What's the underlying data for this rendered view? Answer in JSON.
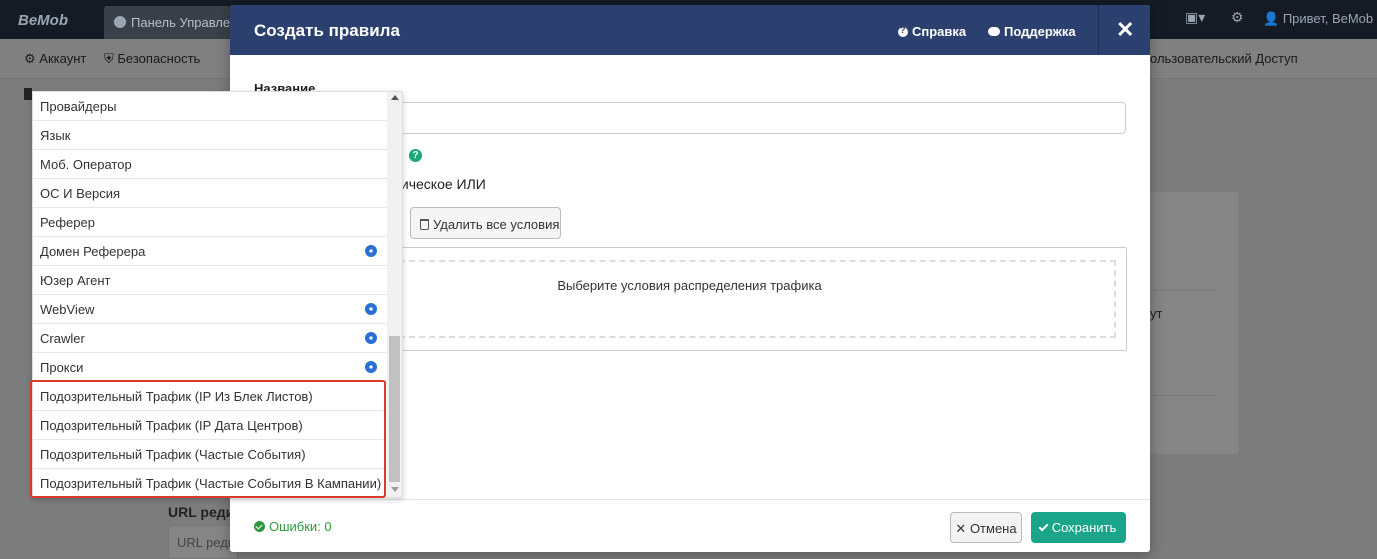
{
  "app": {
    "logo": "BeMob",
    "tab_label": "Панель Управления",
    "greeting": "Привет, BeMob",
    "subnav": {
      "account": "Аккаунт",
      "security": "Безопасность",
      "user_access": "ользовательский Доступ"
    },
    "card_text": "ут",
    "url_label": "URL редир",
    "url_placeholder": "URL редир"
  },
  "modal": {
    "title": "Создать правила",
    "help": "Справка",
    "support": "Поддержка",
    "name_label": "Название",
    "logic_text": "огическое ИЛИ",
    "delete_all": "Удалить все условия",
    "conditions_placeholder": "Выберите условия распределения трафика",
    "errors": "Ошибки: 0",
    "cancel": "Отмена",
    "save": "Сохранить"
  },
  "dropdown": {
    "items": [
      {
        "label": "Провайдеры",
        "badge": false
      },
      {
        "label": "Язык",
        "badge": false
      },
      {
        "label": "Моб. Оператор",
        "badge": false
      },
      {
        "label": "ОС И Версия",
        "badge": false
      },
      {
        "label": "Реферер",
        "badge": false
      },
      {
        "label": "Домен Реферера",
        "badge": true
      },
      {
        "label": "Юзер Агент",
        "badge": false
      },
      {
        "label": "WebView",
        "badge": true
      },
      {
        "label": "Crawler",
        "badge": true
      },
      {
        "label": "Прокси",
        "badge": true
      },
      {
        "label": "Подозрительный Трафик (IP Из Блек Листов)",
        "badge": false
      },
      {
        "label": "Подозрительный Трафик (IP Дата Центров)",
        "badge": false
      },
      {
        "label": "Подозрительный Трафик (Частые События)",
        "badge": false
      },
      {
        "label": "Подозрительный Трафик (Частые События В Кампании)",
        "badge": false
      }
    ]
  },
  "colors": {
    "header": "#2c4070",
    "save": "#1aa58a",
    "badge": "#2a6fd6",
    "highlight": "#d93a2b",
    "success": "#2c9a3c"
  }
}
